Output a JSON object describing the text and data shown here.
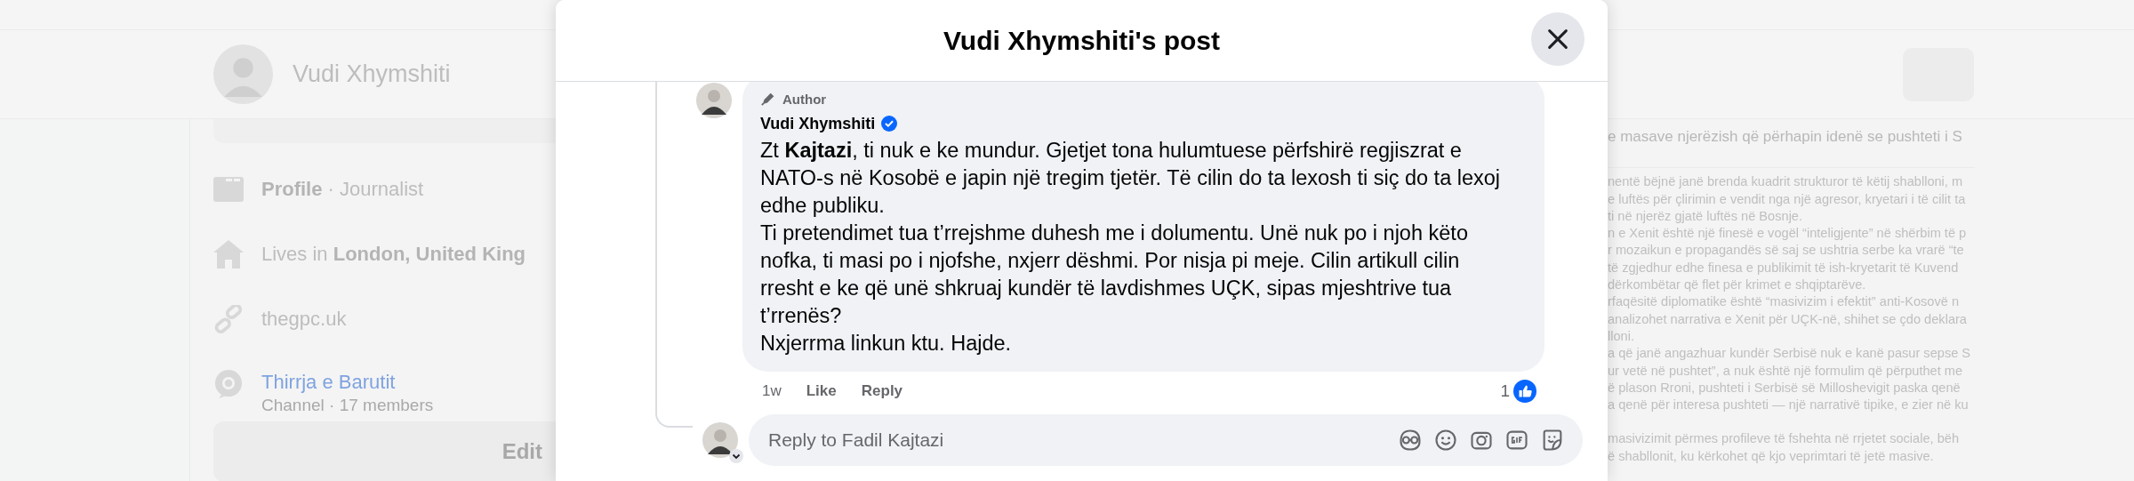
{
  "background": {
    "profile_header": {
      "name": "Vudi Xhymshiti"
    },
    "intro": {
      "items": [
        {
          "kind": "profile",
          "text": "**Profile** · Journalist"
        },
        {
          "kind": "home",
          "text": "Lives in **London, United King**"
        },
        {
          "kind": "link",
          "text": "thegpc.uk"
        },
        {
          "kind": "channel",
          "text": "Thirrja e Barutit",
          "sub": "Channel · 17 members"
        }
      ],
      "edit_button": "Edit"
    },
    "post_preview": {
      "headline": "e masave njerëzish që përhapin idenë se pushteti i S",
      "paragraphs": [
        [
          "nentë bëjnë janë brenda kuadrit strukturor të këtij shablloni, m",
          "e luftës për çlirimin e vendit nga një agresor, kryetari i të cilit ta",
          "ti në njerëz  gjatë luftës në Bosnje.",
          "n e Xenit është një finesë e vogël “inteligjente” në shërbim të p",
          "r mozaikun e propagandës së saj se ushtria serbe ka vrarë “te",
          "të zgjedhur edhe finesa e publikimit të ish-kryetarit të Kuvend",
          "dërkombëtar që flet për krimet e shqiptarëve.",
          "rfaqësitë diplomatike është “masivizim i efektit” anti-Kosovë n",
          "analizohet narrativa e Xenit për UÇK-në, shihet se çdo deklara",
          "lloni.",
          "a që janë angazhuar kundër Serbisë nuk e kanë pasur sepse S",
          "ur vetë në pushtet”, a nuk është një formulim që përputhet me",
          "ë plason Rroni, pushteti i Serbisë së Milloshevigit paska qenë",
          "a qenë për interesa pushteti — një narrativë tipike, e zier në ku"
        ],
        [
          "masivizimit përmes profileve të fshehta në rrjetet sociale, bëh",
          "ë shabllonit, ku kërkohet që kjo veprimtari të jetë masive."
        ]
      ]
    }
  },
  "modal": {
    "title": "Vudi Xhymshiti's post",
    "comment": {
      "badge": "Author",
      "author": "Vudi Xhymshiti",
      "verified": true,
      "paragraphs": [
        "Zt **Kajtazi**, ti nuk e ke mundur. Gjetjet tona hulumtuese përfshirë regjiszrat e NATO-s në Kosobë e japin një tregim tjetër. Të cilin do ta lexosh ti siç do ta lexoj edhe publiku.",
        "Ti pretendimet tua t’rrejshme duhesh me i dolumentu. Unë nuk po i njoh këto nofka, ti masi po i njofshe, nxjerr dëshmi. Por nisja pi meje. Cilin artikull cilin rresht e ke që unë shkruaj kundër të lavdishmes UÇK, sipas mjeshtrive tua t’rrenës?",
        "Nxjerrma linkun ktu. Hajde."
      ],
      "time": "1w",
      "actions": [
        "Like",
        "Reply"
      ],
      "reaction_count": "1"
    },
    "reply_field": {
      "placeholder": "Reply to Fadil Kajtazi"
    }
  }
}
